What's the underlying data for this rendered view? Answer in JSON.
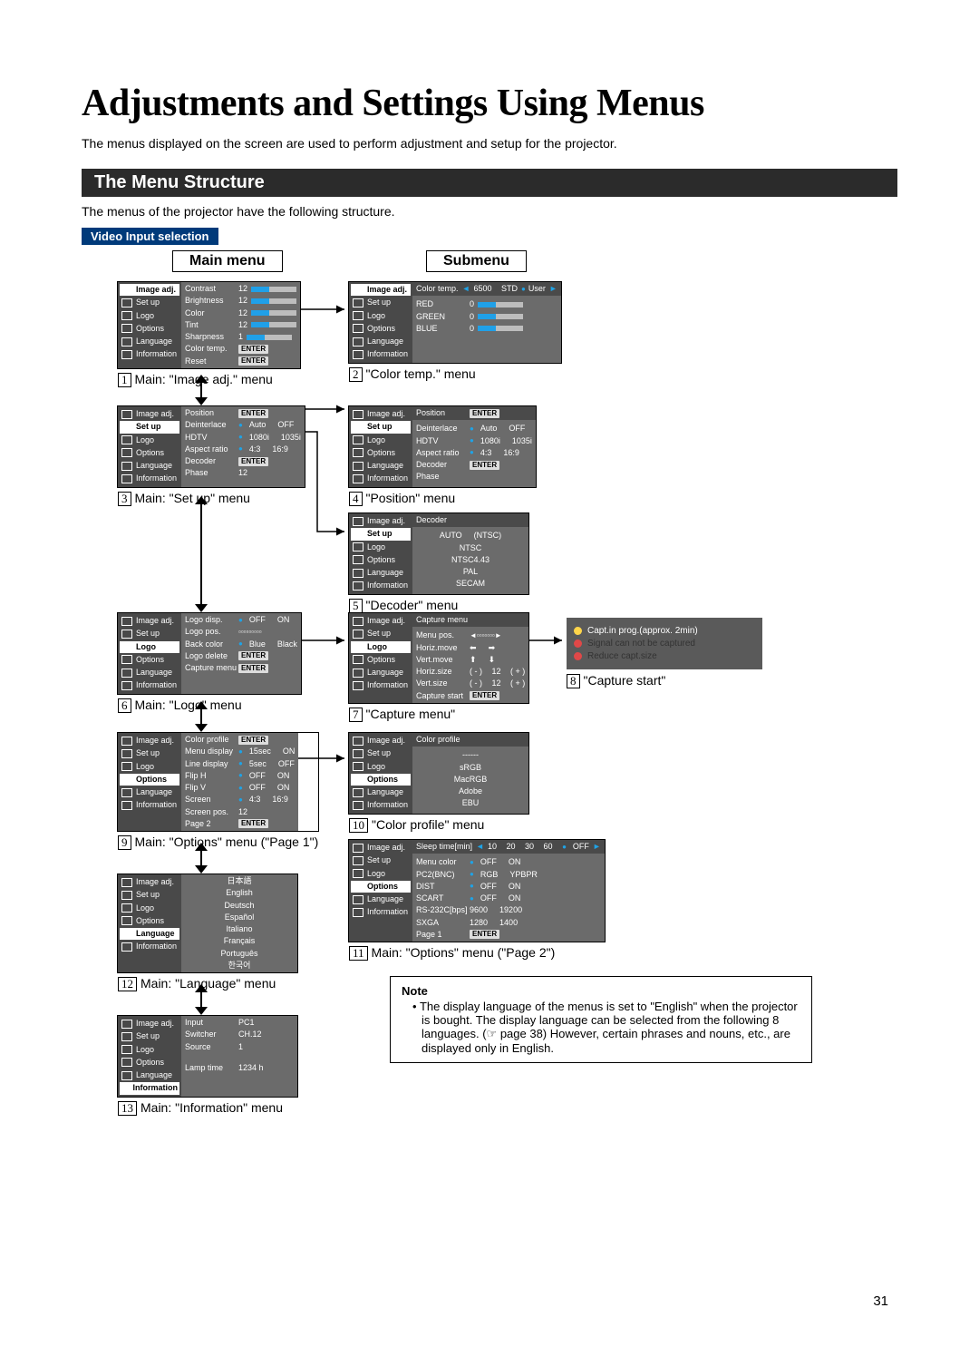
{
  "page_title": "Adjustments and Settings Using Menus",
  "page_number": "31",
  "intro": "The menus displayed on the screen are used to perform adjustment and setup for the projector.",
  "section_bar": "The Menu Structure",
  "structure_note": "The menus of the projector have the following structure.",
  "video_input_tag": "Video Input selection",
  "col_main": "Main menu",
  "col_sub": "Submenu",
  "sidebar_items": [
    "Image adj.",
    "Set up",
    "Logo",
    "Options",
    "Language",
    "Information"
  ],
  "captions": {
    "c1": "Main: \"Image adj.\" menu",
    "c2": "\"Color temp.\" menu",
    "c3": "Main: \"Set up\" menu",
    "c4": "\"Position\" menu",
    "c5": "\"Decoder\" menu",
    "c6": "Main: \"Logo\" menu",
    "c7": "\"Capture menu\"",
    "c8": "\"Capture start\"",
    "c9": "Main: \"Options\" menu (\"Page 1\")",
    "c10": "\"Color profile\" menu",
    "c11": "Main: \"Options\" menu (\"Page 2\")",
    "c12": "Main: \"Language\" menu",
    "c13": "Main: \"Information\" menu"
  },
  "image_adj": {
    "contrast": "Contrast",
    "brightness": "Brightness",
    "color": "Color",
    "tint": "Tint",
    "sharpness": "Sharpness",
    "color_temp": "Color temp.",
    "reset": "Reset",
    "v12": "12",
    "v1": "1"
  },
  "color_temp": {
    "colortemp_label": "Color temp.",
    "v6500": "6500",
    "std": "STD",
    "user": "User",
    "red": "RED",
    "green": "GREEN",
    "blue": "BLUE",
    "zero": "0"
  },
  "setup": {
    "position": "Position",
    "deinterlace": "Deinterlace",
    "auto": "Auto",
    "off": "OFF",
    "hdtv": "HDTV",
    "hd1080": "1080i",
    "hd1035": "1035i",
    "aspect": "Aspect ratio",
    "a43": "4:3",
    "a169": "16:9",
    "decoder": "Decoder",
    "phase": "Phase",
    "phase_v": "12"
  },
  "position": {
    "title": "Position",
    "enter": "ENTER",
    "deinterlace": "Deinterlace",
    "auto": "Auto",
    "off": "OFF",
    "hdtv": "HDTV",
    "hd1080": "1080i",
    "hd1035": "1035i",
    "aspect": "Aspect ratio",
    "a43": "4:3",
    "a169": "16:9",
    "decoder": "Decoder",
    "phase": "Phase"
  },
  "decoder": {
    "title": "Decoder",
    "auto": "AUTO",
    "ntsc_cur": "(NTSC)",
    "ntsc": "NTSC",
    "ntsc443": "NTSC4.43",
    "pal": "PAL",
    "secam": "SECAM"
  },
  "logo": {
    "logo_disp": "Logo disp.",
    "off": "OFF",
    "on": "ON",
    "logo_pos": "Logo pos.",
    "back": "Back color",
    "blue": "Blue",
    "black": "Black",
    "del": "Logo delete",
    "cap": "Capture menu"
  },
  "capture_menu": {
    "title": "Capture menu",
    "menupos": "Menu pos.",
    "hmove": "Horiz.move",
    "vmove": "Vert.move",
    "hsize": "Horiz.size",
    "vsize": "Vert.size",
    "minus": "( - )",
    "plus": "( + )",
    "v12": "12",
    "start": "Capture start"
  },
  "capture_start": {
    "l1": "Capt.in prog.(approx. 2min)",
    "l2": "Signal can not be captured",
    "l3": "Reduce capt.size"
  },
  "options1": {
    "colorprof": "Color profile",
    "menudisp": "Menu display",
    "md15": "15sec",
    "on": "ON",
    "linedisp": "Line display",
    "ld5": "5sec",
    "off": "OFF",
    "fliph": "Flip H",
    "flipv": "Flip V",
    "screen": "Screen",
    "s43": "4:3",
    "s169": "16:9",
    "scrpos": "Screen pos.",
    "spv": "12",
    "page2": "Page 2"
  },
  "color_profile": {
    "title": "Color profile",
    "dash": "------",
    "srgb": "sRGB",
    "macrgb": "MacRGB",
    "adobe": "Adobe",
    "ebu": "EBU"
  },
  "options2": {
    "sleep": "Sleep time[min]",
    "s10": "10",
    "s20": "20",
    "s30": "30",
    "s60": "60",
    "soff": "OFF",
    "menucol": "Menu color",
    "off": "OFF",
    "on": "ON",
    "pc2": "PC2(BNC)",
    "rgb": "RGB",
    "ypbpr": "YPBPR",
    "dist": "DIST",
    "scart": "SCART",
    "rs232": "RS-232C[bps]",
    "b96": "9600",
    "b192": "19200",
    "sxga": "SXGA",
    "s1280": "1280",
    "s1400": "1400",
    "page1": "Page 1"
  },
  "language": {
    "jp": "日本語",
    "en": "English",
    "de": "Deutsch",
    "es": "Español",
    "it": "Italiano",
    "fr": "Français",
    "pt": "Português",
    "ko": "한국어"
  },
  "information": {
    "input": "Input",
    "input_v": "PC1",
    "switcher": "Switcher",
    "switcher_v": "CH.12",
    "source": "Source",
    "source_v": "1",
    "lamp": "Lamp time",
    "lamp_v": "1234 h"
  },
  "note": {
    "heading": "Note",
    "body": "The display language of the menus is set to \"English\" when the projector is bought. The display language can be selected from the following 8 languages. (☞ page 38) However, certain phrases and nouns, etc., are displayed only in English."
  }
}
